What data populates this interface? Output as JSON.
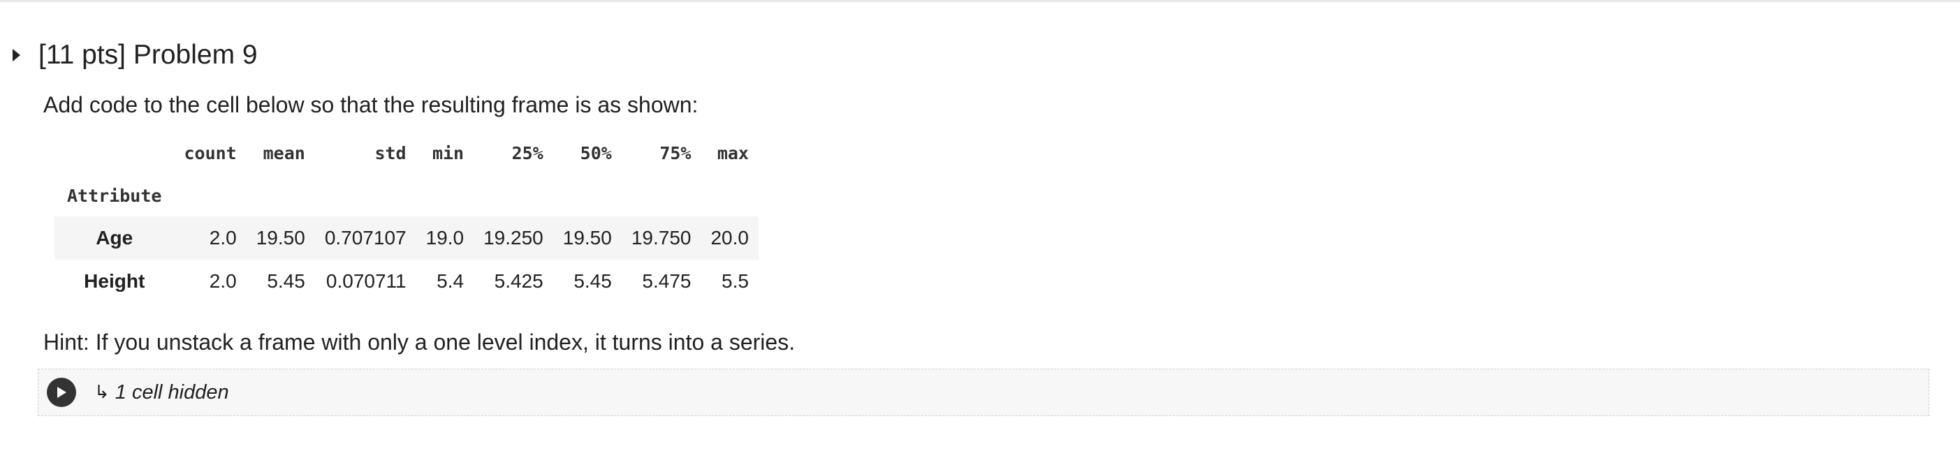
{
  "section": {
    "title": "[11 pts] Problem 9"
  },
  "instructions": "Add code to the cell below so that the resulting frame is as shown:",
  "table": {
    "columns": [
      "count",
      "mean",
      "std",
      "min",
      "25%",
      "50%",
      "75%",
      "max"
    ],
    "index_name": "Attribute",
    "rows": [
      {
        "label": "Age",
        "values": [
          "2.0",
          "19.50",
          "0.707107",
          "19.0",
          "19.250",
          "19.50",
          "19.750",
          "20.0"
        ]
      },
      {
        "label": "Height",
        "values": [
          "2.0",
          "5.45",
          "0.070711",
          "5.4",
          "5.425",
          "5.45",
          "5.475",
          "5.5"
        ]
      }
    ]
  },
  "hint": "Hint: If you unstack a frame with only a one level index, it turns into a series.",
  "hidden_cells": {
    "arrow": "↳",
    "label": "1 cell hidden"
  },
  "icons": {
    "expand": "caret-right-icon",
    "run": "play-icon"
  }
}
